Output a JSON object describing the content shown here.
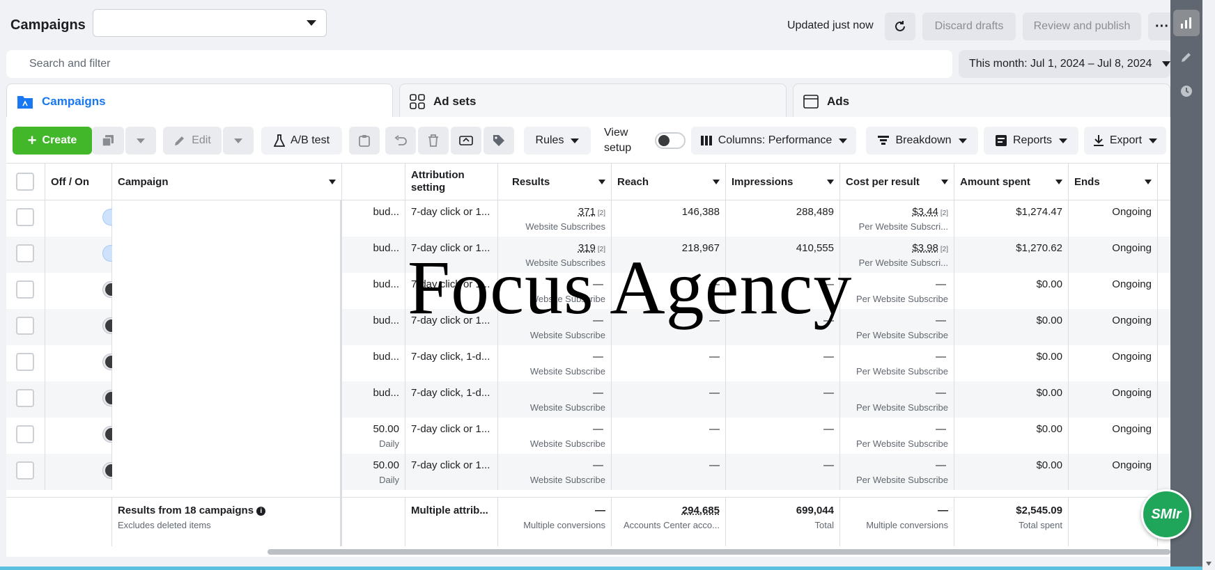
{
  "header": {
    "title": "Campaigns",
    "updated": "Updated just now",
    "discard": "Discard drafts",
    "review": "Review and publish",
    "more": "···"
  },
  "search": {
    "placeholder": "Search and filter"
  },
  "date_range": "This month: Jul 1, 2024 – Jul 8, 2024",
  "tabs": [
    {
      "label": "Campaigns"
    },
    {
      "label": "Ad sets"
    },
    {
      "label": "Ads"
    }
  ],
  "toolbar": {
    "create": "Create",
    "edit": "Edit",
    "ab_test": "A/B test",
    "rules": "Rules",
    "view_setup": "View setup",
    "columns": "Columns: Performance",
    "breakdown": "Breakdown",
    "reports": "Reports",
    "export": "Export"
  },
  "columns": {
    "offon": "Off / On",
    "campaign": "Campaign",
    "attribution": "Attribution setting",
    "results": "Results",
    "reach": "Reach",
    "impressions": "Impressions",
    "cpr": "Cost per result",
    "spent": "Amount spent",
    "ends": "Ends"
  },
  "rows": [
    {
      "on": true,
      "budget": "bud...",
      "budget_sub": "",
      "attribution": "7-day click or 1...",
      "results": "371",
      "results_note": "[2]",
      "results_sub": "Website Subscribes",
      "reach": "146,388",
      "impressions": "288,489",
      "cpr": "$3.44",
      "cpr_note": "[2]",
      "cpr_sub": "Per Website Subscri...",
      "spent": "$1,274.47",
      "ends": "Ongoing"
    },
    {
      "on": true,
      "budget": "bud...",
      "budget_sub": "",
      "attribution": "7-day click or 1...",
      "results": "319",
      "results_note": "[2]",
      "results_sub": "Website Subscribes",
      "reach": "218,967",
      "impressions": "410,555",
      "cpr": "$3.98",
      "cpr_note": "[2]",
      "cpr_sub": "Per Website Subscri...",
      "spent": "$1,270.62",
      "ends": "Ongoing"
    },
    {
      "on": false,
      "budget": "bud...",
      "budget_sub": "",
      "attribution": "7-day click or 1...",
      "results": "—",
      "results_note": "",
      "results_sub": "Website Subscribe",
      "reach": "—",
      "impressions": "—",
      "cpr": "—",
      "cpr_note": "",
      "cpr_sub": "Per Website Subscribe",
      "spent": "$0.00",
      "ends": "Ongoing"
    },
    {
      "on": false,
      "budget": "bud...",
      "budget_sub": "",
      "attribution": "7-day click or 1...",
      "results": "—",
      "results_note": "",
      "results_sub": "Website Subscribe",
      "reach": "—",
      "impressions": "—",
      "cpr": "—",
      "cpr_note": "",
      "cpr_sub": "Per Website Subscribe",
      "spent": "$0.00",
      "ends": "Ongoing"
    },
    {
      "on": false,
      "budget": "bud...",
      "budget_sub": "",
      "attribution": "7-day click, 1-d...",
      "results": "—",
      "results_note": "",
      "results_sub": "Website Subscribe",
      "reach": "—",
      "impressions": "—",
      "cpr": "—",
      "cpr_note": "",
      "cpr_sub": "Per Website Subscribe",
      "spent": "$0.00",
      "ends": "Ongoing"
    },
    {
      "on": false,
      "budget": "bud...",
      "budget_sub": "",
      "attribution": "7-day click, 1-d...",
      "results": "—",
      "results_note": "",
      "results_sub": "Website Subscribe",
      "reach": "—",
      "impressions": "—",
      "cpr": "—",
      "cpr_note": "",
      "cpr_sub": "Per Website Subscribe",
      "spent": "$0.00",
      "ends": "Ongoing"
    },
    {
      "on": false,
      "budget": "50.00",
      "budget_sub": "Daily",
      "attribution": "7-day click or 1...",
      "results": "—",
      "results_note": "",
      "results_sub": "Website Subscribe",
      "reach": "—",
      "impressions": "—",
      "cpr": "—",
      "cpr_note": "",
      "cpr_sub": "Per Website Subscribe",
      "spent": "$0.00",
      "ends": "Ongoing"
    },
    {
      "on": false,
      "budget": "50.00",
      "budget_sub": "Daily",
      "attribution": "7-day click or 1...",
      "results": "—",
      "results_note": "",
      "results_sub": "Website Subscribe",
      "reach": "—",
      "impressions": "—",
      "cpr": "—",
      "cpr_note": "",
      "cpr_sub": "Per Website Subscribe",
      "spent": "$0.00",
      "ends": "Ongoing"
    }
  ],
  "summary": {
    "label": "Results from 18 campaigns",
    "sub": "Excludes deleted items",
    "attribution": "Multiple attrib...",
    "results": "—",
    "results_sub": "Multiple conversions",
    "reach": "294,685",
    "reach_sub": "Accounts Center acco...",
    "impressions": "699,044",
    "impressions_sub": "Total",
    "cpr": "—",
    "cpr_sub": "Multiple conversions",
    "spent": "$2,545.09",
    "spent_sub": "Total spent"
  },
  "watermark": "Focus Agency",
  "badge": "SMIr",
  "colors": {
    "accent": "#1877f2",
    "create": "#42b72a",
    "badge": "#1fa65a"
  }
}
